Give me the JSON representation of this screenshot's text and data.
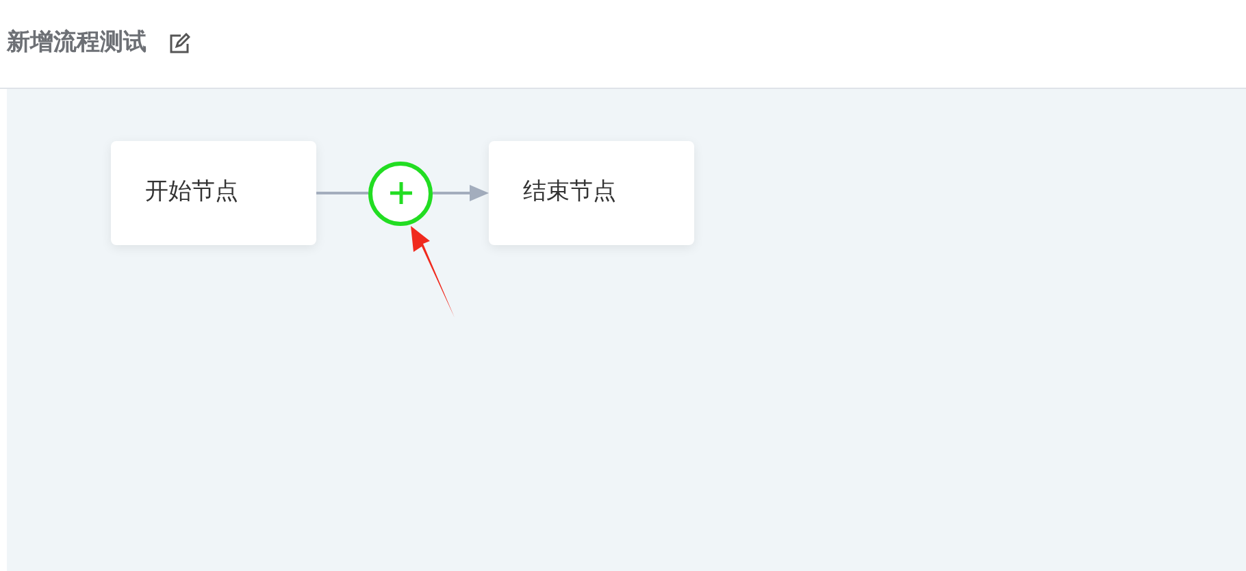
{
  "flow": {
    "title": "新增流程测试"
  },
  "nodes": [
    {
      "label": "开始节点"
    },
    {
      "label": "结束节点"
    }
  ]
}
